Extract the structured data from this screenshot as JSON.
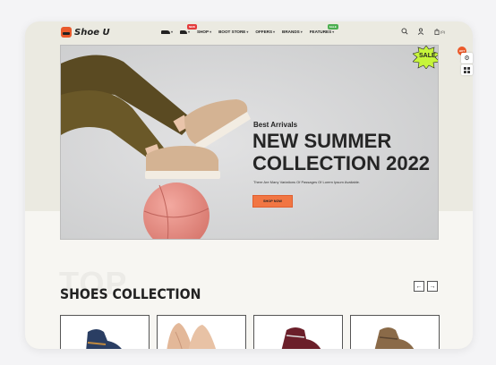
{
  "brand": {
    "name": "Shoe U",
    "accent": "#e95a2b"
  },
  "nav": {
    "items": [
      {
        "label": "",
        "icon": "shoe-icon",
        "badge": ""
      },
      {
        "label": "",
        "icon": "shoe-icon",
        "badge": "NEW",
        "badge_color": "#e43c3c"
      },
      {
        "label": "SHOP",
        "badge": ""
      },
      {
        "label": "BOOT STORE",
        "badge": ""
      },
      {
        "label": "OFFERS",
        "badge": ""
      },
      {
        "label": "BRANDS",
        "badge": ""
      },
      {
        "label": "FEATURES",
        "badge": "SALE",
        "badge_color": "#4caf50"
      }
    ]
  },
  "header_icons": [
    "search-icon",
    "user-icon",
    "cart-icon"
  ],
  "cart": {
    "count": "(0)"
  },
  "hero": {
    "subtitle": "Best Arrivals",
    "title_line1": "NEW SUMMER",
    "title_line2": "COLLECTION 2022",
    "description": "There Are Many Variations Of Passages Of Lorem Ipsum Available.",
    "button_label": "SHOP NOW",
    "sale_label": "SALE",
    "sale_color": "#c6f53b"
  },
  "floating": {
    "badge_label": "HOT",
    "settings_icon": "gear-icon",
    "layout_icon": "grid-icon"
  },
  "section": {
    "ghost_text": "TOP",
    "title": "SHOES COLLECTION",
    "prev_label": "←",
    "next_label": "→"
  },
  "products": [
    {
      "icon": "boot-icon",
      "color": "#2a3e63"
    },
    {
      "icon": "heels-icon",
      "color": "#e3b899"
    },
    {
      "icon": "boot-icon",
      "color": "#6b1f2a"
    },
    {
      "icon": "boot-icon",
      "color": "#8a6a48"
    }
  ]
}
